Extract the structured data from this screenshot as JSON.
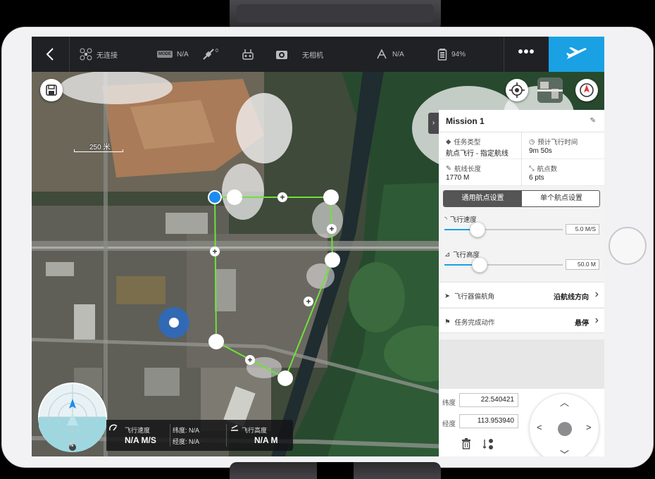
{
  "topbar": {
    "connection": "无连接",
    "mode_badge": "MODE",
    "mode_value": "N/A",
    "gps_count": "0",
    "camera": "无相机",
    "signal_value": "N/A",
    "battery": "94%",
    "more": "•••"
  },
  "map": {
    "scale": "250 米"
  },
  "panel": {
    "tab_arrow": "›",
    "title": "Mission 1",
    "edit": "✎",
    "info": [
      {
        "label": "任务类型",
        "value": "航点飞行 - 指定航线"
      },
      {
        "label": "预计飞行时间",
        "value": "9m 50s"
      },
      {
        "label": "航线长度",
        "value": "1770 M"
      },
      {
        "label": "航点数",
        "value": "6 pts"
      }
    ],
    "tabs": {
      "general": "通用航点设置",
      "single": "单个航点设置"
    },
    "speed": {
      "label": "飞行速度",
      "value": "5.0 M/S",
      "fraction": 0.28
    },
    "altitude": {
      "label": "飞行高度",
      "value": "50.0 M",
      "fraction": 0.3
    },
    "heading": {
      "label": "飞行器偏航角",
      "value": "沿航线方向"
    },
    "finish": {
      "label": "任务完成动作",
      "value": "悬停"
    },
    "lat_label": "纬度",
    "lat_value": "22.540421",
    "lng_label": "经度",
    "lng_value": "113.953940"
  },
  "telemetry": {
    "speed_label": "飞行速度",
    "speed_value": "N/A M/S",
    "lat": "纬度: N/A",
    "lng": "经度: N/A",
    "alt_label": "飞行高度",
    "alt_value": "N/A M"
  },
  "compass": {
    "north": "N"
  },
  "colors": {
    "accent": "#1aa1e3",
    "route": "#6fe23a"
  }
}
